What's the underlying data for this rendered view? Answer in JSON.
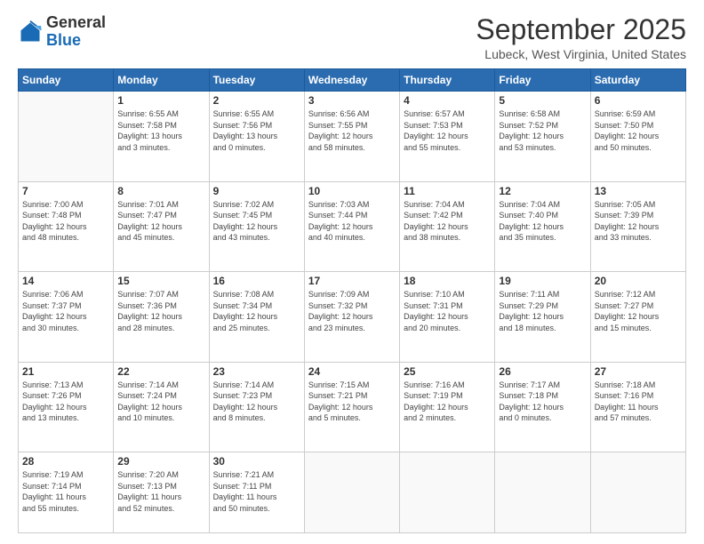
{
  "header": {
    "logo_general": "General",
    "logo_blue": "Blue",
    "title": "September 2025",
    "subtitle": "Lubeck, West Virginia, United States"
  },
  "days_of_week": [
    "Sunday",
    "Monday",
    "Tuesday",
    "Wednesday",
    "Thursday",
    "Friday",
    "Saturday"
  ],
  "weeks": [
    [
      {
        "day": "",
        "info": ""
      },
      {
        "day": "1",
        "info": "Sunrise: 6:55 AM\nSunset: 7:58 PM\nDaylight: 13 hours\nand 3 minutes."
      },
      {
        "day": "2",
        "info": "Sunrise: 6:55 AM\nSunset: 7:56 PM\nDaylight: 13 hours\nand 0 minutes."
      },
      {
        "day": "3",
        "info": "Sunrise: 6:56 AM\nSunset: 7:55 PM\nDaylight: 12 hours\nand 58 minutes."
      },
      {
        "day": "4",
        "info": "Sunrise: 6:57 AM\nSunset: 7:53 PM\nDaylight: 12 hours\nand 55 minutes."
      },
      {
        "day": "5",
        "info": "Sunrise: 6:58 AM\nSunset: 7:52 PM\nDaylight: 12 hours\nand 53 minutes."
      },
      {
        "day": "6",
        "info": "Sunrise: 6:59 AM\nSunset: 7:50 PM\nDaylight: 12 hours\nand 50 minutes."
      }
    ],
    [
      {
        "day": "7",
        "info": "Sunrise: 7:00 AM\nSunset: 7:48 PM\nDaylight: 12 hours\nand 48 minutes."
      },
      {
        "day": "8",
        "info": "Sunrise: 7:01 AM\nSunset: 7:47 PM\nDaylight: 12 hours\nand 45 minutes."
      },
      {
        "day": "9",
        "info": "Sunrise: 7:02 AM\nSunset: 7:45 PM\nDaylight: 12 hours\nand 43 minutes."
      },
      {
        "day": "10",
        "info": "Sunrise: 7:03 AM\nSunset: 7:44 PM\nDaylight: 12 hours\nand 40 minutes."
      },
      {
        "day": "11",
        "info": "Sunrise: 7:04 AM\nSunset: 7:42 PM\nDaylight: 12 hours\nand 38 minutes."
      },
      {
        "day": "12",
        "info": "Sunrise: 7:04 AM\nSunset: 7:40 PM\nDaylight: 12 hours\nand 35 minutes."
      },
      {
        "day": "13",
        "info": "Sunrise: 7:05 AM\nSunset: 7:39 PM\nDaylight: 12 hours\nand 33 minutes."
      }
    ],
    [
      {
        "day": "14",
        "info": "Sunrise: 7:06 AM\nSunset: 7:37 PM\nDaylight: 12 hours\nand 30 minutes."
      },
      {
        "day": "15",
        "info": "Sunrise: 7:07 AM\nSunset: 7:36 PM\nDaylight: 12 hours\nand 28 minutes."
      },
      {
        "day": "16",
        "info": "Sunrise: 7:08 AM\nSunset: 7:34 PM\nDaylight: 12 hours\nand 25 minutes."
      },
      {
        "day": "17",
        "info": "Sunrise: 7:09 AM\nSunset: 7:32 PM\nDaylight: 12 hours\nand 23 minutes."
      },
      {
        "day": "18",
        "info": "Sunrise: 7:10 AM\nSunset: 7:31 PM\nDaylight: 12 hours\nand 20 minutes."
      },
      {
        "day": "19",
        "info": "Sunrise: 7:11 AM\nSunset: 7:29 PM\nDaylight: 12 hours\nand 18 minutes."
      },
      {
        "day": "20",
        "info": "Sunrise: 7:12 AM\nSunset: 7:27 PM\nDaylight: 12 hours\nand 15 minutes."
      }
    ],
    [
      {
        "day": "21",
        "info": "Sunrise: 7:13 AM\nSunset: 7:26 PM\nDaylight: 12 hours\nand 13 minutes."
      },
      {
        "day": "22",
        "info": "Sunrise: 7:14 AM\nSunset: 7:24 PM\nDaylight: 12 hours\nand 10 minutes."
      },
      {
        "day": "23",
        "info": "Sunrise: 7:14 AM\nSunset: 7:23 PM\nDaylight: 12 hours\nand 8 minutes."
      },
      {
        "day": "24",
        "info": "Sunrise: 7:15 AM\nSunset: 7:21 PM\nDaylight: 12 hours\nand 5 minutes."
      },
      {
        "day": "25",
        "info": "Sunrise: 7:16 AM\nSunset: 7:19 PM\nDaylight: 12 hours\nand 2 minutes."
      },
      {
        "day": "26",
        "info": "Sunrise: 7:17 AM\nSunset: 7:18 PM\nDaylight: 12 hours\nand 0 minutes."
      },
      {
        "day": "27",
        "info": "Sunrise: 7:18 AM\nSunset: 7:16 PM\nDaylight: 11 hours\nand 57 minutes."
      }
    ],
    [
      {
        "day": "28",
        "info": "Sunrise: 7:19 AM\nSunset: 7:14 PM\nDaylight: 11 hours\nand 55 minutes."
      },
      {
        "day": "29",
        "info": "Sunrise: 7:20 AM\nSunset: 7:13 PM\nDaylight: 11 hours\nand 52 minutes."
      },
      {
        "day": "30",
        "info": "Sunrise: 7:21 AM\nSunset: 7:11 PM\nDaylight: 11 hours\nand 50 minutes."
      },
      {
        "day": "",
        "info": ""
      },
      {
        "day": "",
        "info": ""
      },
      {
        "day": "",
        "info": ""
      },
      {
        "day": "",
        "info": ""
      }
    ]
  ]
}
